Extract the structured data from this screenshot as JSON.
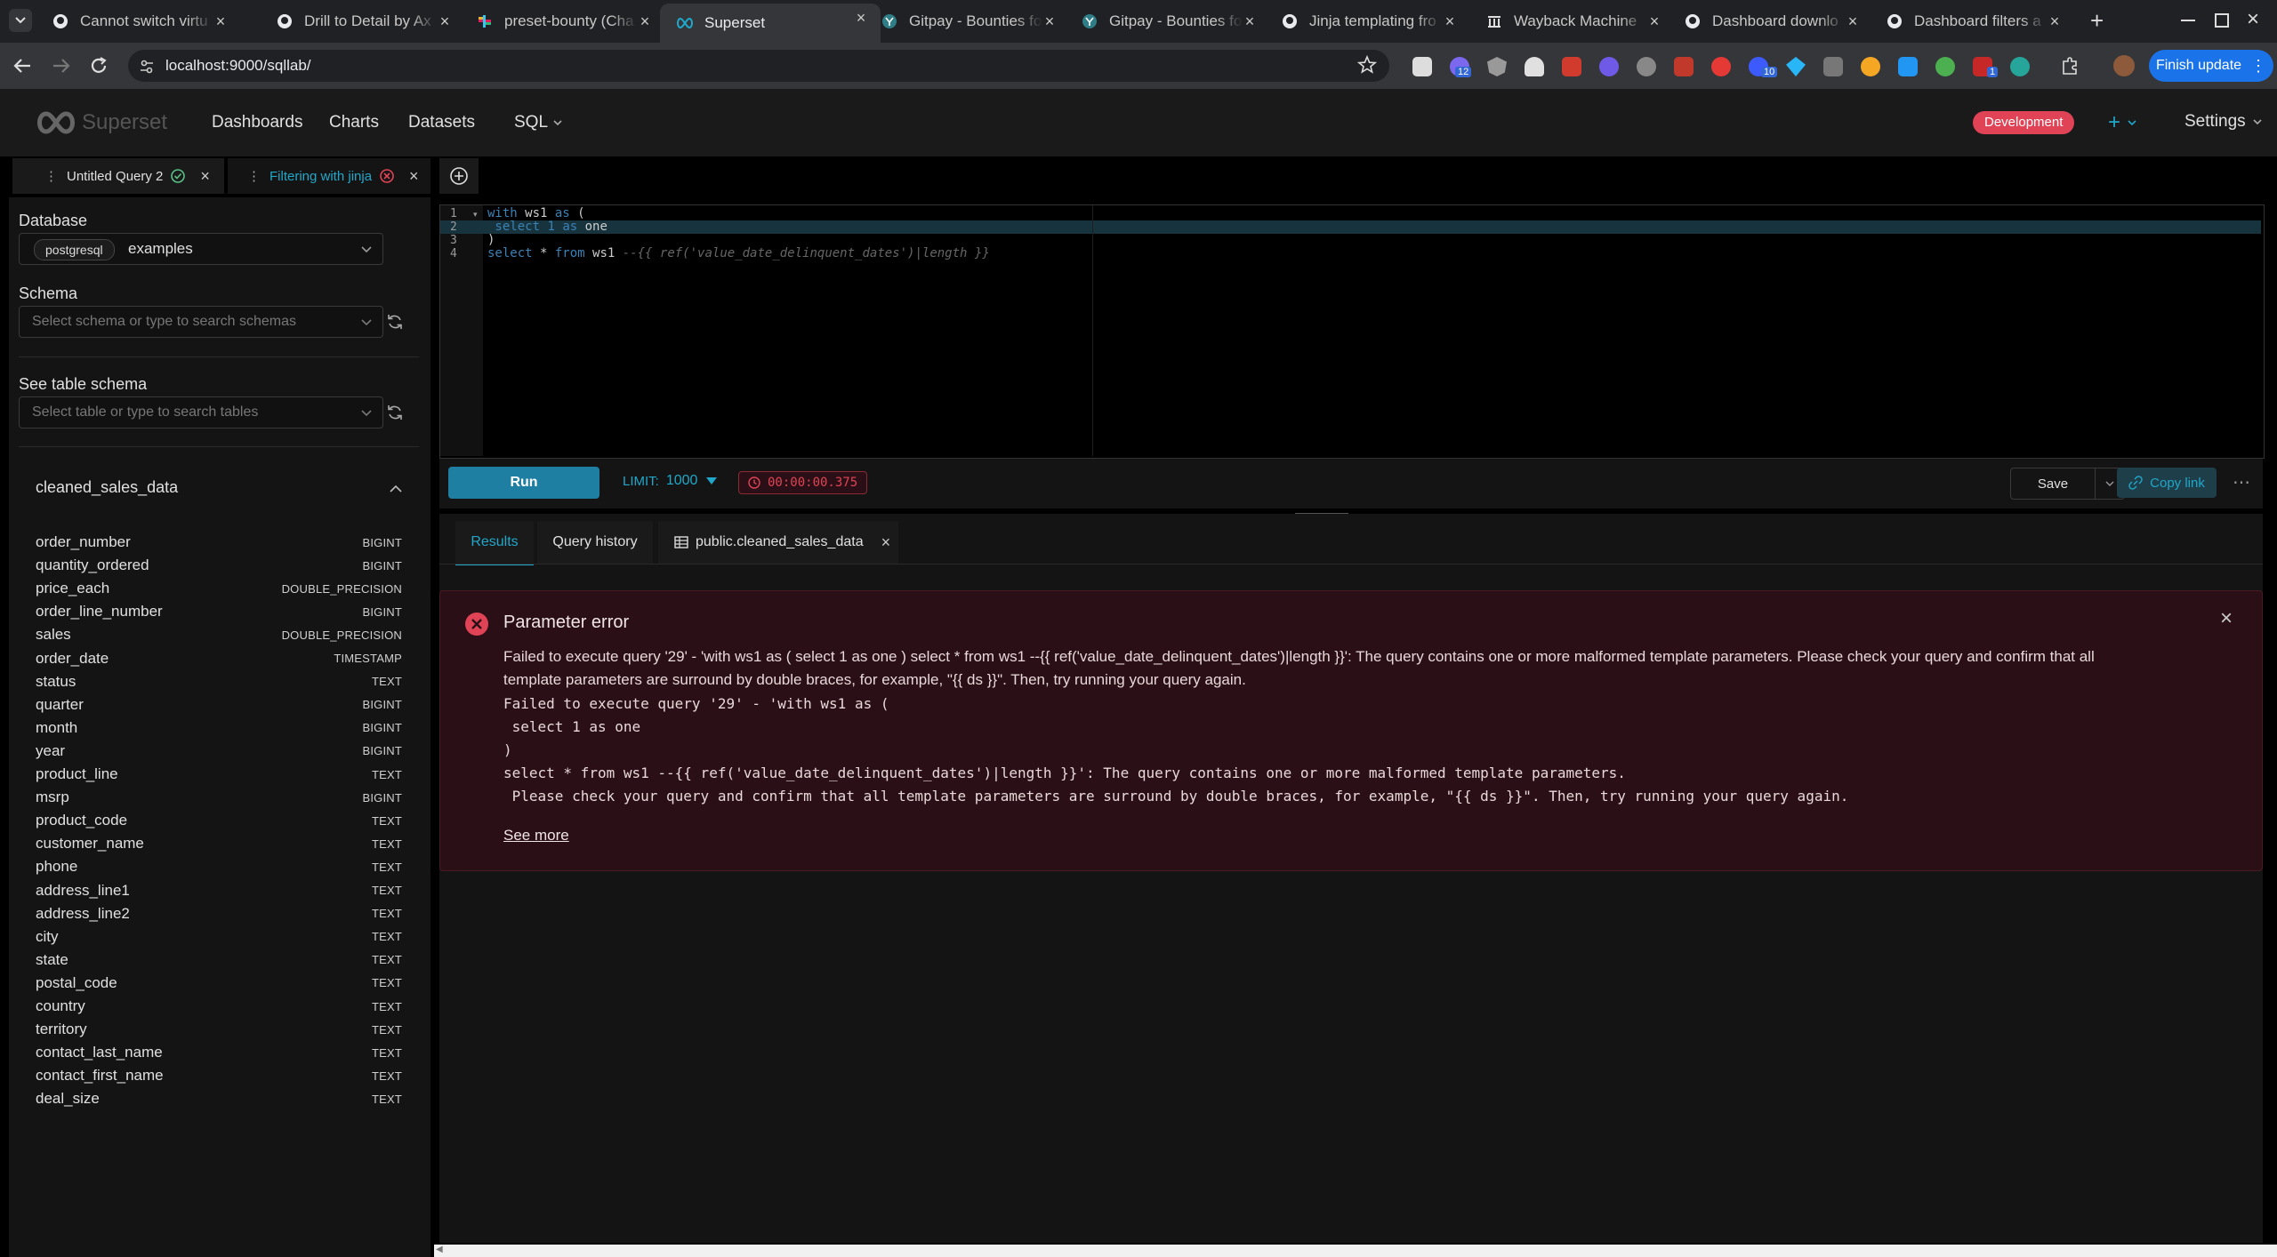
{
  "browser": {
    "tabs": [
      {
        "title": "Cannot switch virtu",
        "icon": "github-icon"
      },
      {
        "title": "Drill to Detail by Ax",
        "icon": "github-icon"
      },
      {
        "title": "preset-bounty (Cha",
        "icon": "slack-icon"
      },
      {
        "title": "Superset",
        "icon": "superset-icon",
        "active": true
      },
      {
        "title": "Gitpay - Bounties fo",
        "icon": "gitpay-icon"
      },
      {
        "title": "Gitpay - Bounties fo",
        "icon": "gitpay-icon"
      },
      {
        "title": "Jinja templating fro",
        "icon": "github-icon"
      },
      {
        "title": "Wayback Machine",
        "icon": "wayback-icon"
      },
      {
        "title": "Dashboard downlo",
        "icon": "github-icon"
      },
      {
        "title": "Dashboard filters a",
        "icon": "github-icon"
      }
    ],
    "url": "localhost:9000/sqllab/",
    "update_button": "Finish update",
    "ext_badges": [
      "12",
      "10",
      "1"
    ]
  },
  "header": {
    "logo_text": "Superset",
    "nav": [
      "Dashboards",
      "Charts",
      "Datasets",
      "SQL"
    ],
    "env_badge": "Development",
    "plus_label": "+",
    "settings_label": "Settings"
  },
  "query_tabs": [
    {
      "label": "Untitled Query 2",
      "status": "success"
    },
    {
      "label": "Filtering with jinja",
      "status": "error",
      "active": true
    }
  ],
  "left_panel": {
    "database_label": "Database",
    "database_engine": "postgresql",
    "database_name": "examples",
    "schema_label": "Schema",
    "schema_placeholder": "Select schema or type to search schemas",
    "table_schema_label": "See table schema",
    "table_placeholder": "Select table or type to search tables",
    "table_name": "cleaned_sales_data",
    "columns": [
      {
        "name": "order_number",
        "type": "BIGINT"
      },
      {
        "name": "quantity_ordered",
        "type": "BIGINT"
      },
      {
        "name": "price_each",
        "type": "DOUBLE_PRECISION"
      },
      {
        "name": "order_line_number",
        "type": "BIGINT"
      },
      {
        "name": "sales",
        "type": "DOUBLE_PRECISION"
      },
      {
        "name": "order_date",
        "type": "TIMESTAMP"
      },
      {
        "name": "status",
        "type": "TEXT"
      },
      {
        "name": "quarter",
        "type": "BIGINT"
      },
      {
        "name": "month",
        "type": "BIGINT"
      },
      {
        "name": "year",
        "type": "BIGINT"
      },
      {
        "name": "product_line",
        "type": "TEXT"
      },
      {
        "name": "msrp",
        "type": "BIGINT"
      },
      {
        "name": "product_code",
        "type": "TEXT"
      },
      {
        "name": "customer_name",
        "type": "TEXT"
      },
      {
        "name": "phone",
        "type": "TEXT"
      },
      {
        "name": "address_line1",
        "type": "TEXT"
      },
      {
        "name": "address_line2",
        "type": "TEXT"
      },
      {
        "name": "city",
        "type": "TEXT"
      },
      {
        "name": "state",
        "type": "TEXT"
      },
      {
        "name": "postal_code",
        "type": "TEXT"
      },
      {
        "name": "country",
        "type": "TEXT"
      },
      {
        "name": "territory",
        "type": "TEXT"
      },
      {
        "name": "contact_last_name",
        "type": "TEXT"
      },
      {
        "name": "contact_first_name",
        "type": "TEXT"
      },
      {
        "name": "deal_size",
        "type": "TEXT"
      }
    ]
  },
  "editor": {
    "line_numbers": [
      "1",
      "2",
      "3",
      "4"
    ],
    "line1_kw1": "with",
    "line1_rest": " ws1 ",
    "line1_kw2": "as",
    "line1_end": " (",
    "line2_kw1": " select",
    "line2_num": " 1 ",
    "line2_kw2": "as",
    "line2_rest": " one",
    "line3": ")",
    "line4_kw1": "select",
    "line4_mid": " * ",
    "line4_kw2": "from",
    "line4_rest": " ws1 ",
    "line4_comment": "--{{ ref('value_date_delinquent_dates')|length }}"
  },
  "toolbar": {
    "run_label": "Run",
    "limit_label": "LIMIT:",
    "limit_value": "1000",
    "timer": "00:00:00.375",
    "save_label": "Save",
    "copy_link_label": "Copy link"
  },
  "results": {
    "tabs": [
      "Results",
      "Query history",
      "public.cleaned_sales_data"
    ],
    "error_title": "Parameter error",
    "error_line1": "Failed to execute query '29' - 'with ws1 as ( select 1 as one ) select * from ws1 --{{ ref('value_date_delinquent_dates')|length }}': The query contains one or more malformed template parameters. Please check your query and confirm that all",
    "error_line2": "template parameters are surround by double braces, for example, \"{{ ds }}\". Then, try running your query again.",
    "mono_lines": [
      "Failed to execute query '29' - 'with ws1 as (",
      " select 1 as one",
      ")",
      "select * from ws1 --{{ ref('value_date_delinquent_dates')|length }}': The query contains one or more malformed template parameters.",
      " Please check your query and confirm that all template parameters are surround by double braces, for example, \"{{ ds }}\". Then, try running your query again."
    ],
    "see_more": "See more"
  },
  "colors": {
    "accent": "#20a7c9",
    "error": "#e04355",
    "env_badge": "#e04355",
    "update_button": "#1a73e8"
  }
}
